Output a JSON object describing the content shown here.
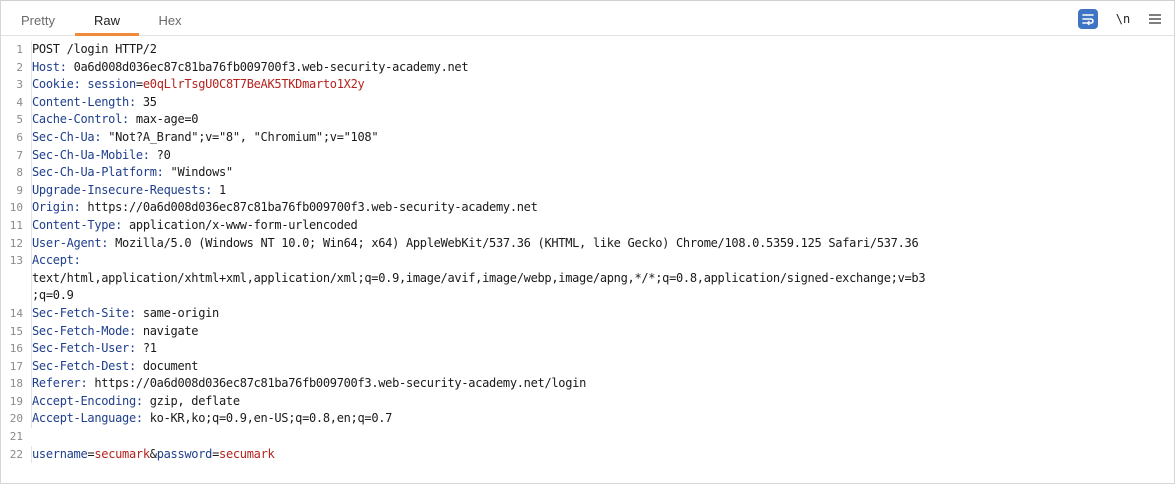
{
  "tabs": [
    {
      "label": "Pretty",
      "active": false
    },
    {
      "label": "Raw",
      "active": true
    },
    {
      "label": "Hex",
      "active": false
    }
  ],
  "toolbar": {
    "wrap_icon": "word-wrap-icon",
    "newline_label": "\\n",
    "menu_icon": "hamburger-menu-icon",
    "accent_color": "#3f74c4",
    "active_tab_color": "#f28a3b"
  },
  "request": {
    "line1": {
      "num": "1",
      "text": "POST /login HTTP/2"
    },
    "line2": {
      "num": "2",
      "name": "Host",
      "value": " 0a6d008d036ec87c81ba76fb009700f3.web-security-academy.net"
    },
    "line3": {
      "num": "3",
      "name": "Cookie",
      "cookie_name": "session",
      "cookie_value": "e0qLlrTsgU0C8T7BeAK5TKDmarto1X2y"
    },
    "line4": {
      "num": "4",
      "name": "Content-Length",
      "value": " 35"
    },
    "line5": {
      "num": "5",
      "name": "Cache-Control",
      "value": " max-age=0"
    },
    "line6": {
      "num": "6",
      "name": "Sec-Ch-Ua",
      "value": " \"Not?A_Brand\";v=\"8\", \"Chromium\";v=\"108\""
    },
    "line7": {
      "num": "7",
      "name": "Sec-Ch-Ua-Mobile",
      "value": " ?0"
    },
    "line8": {
      "num": "8",
      "name": "Sec-Ch-Ua-Platform",
      "value": " \"Windows\""
    },
    "line9": {
      "num": "9",
      "name": "Upgrade-Insecure-Requests",
      "value": " 1"
    },
    "line10": {
      "num": "10",
      "name": "Origin",
      "value": " https://0a6d008d036ec87c81ba76fb009700f3.web-security-academy.net"
    },
    "line11": {
      "num": "11",
      "name": "Content-Type",
      "value": " application/x-www-form-urlencoded"
    },
    "line12": {
      "num": "12",
      "name": "User-Agent",
      "value": " Mozilla/5.0 (Windows NT 10.0; Win64; x64) AppleWebKit/537.36 (KHTML, like Gecko) Chrome/108.0.5359.125 Safari/537.36"
    },
    "line13": {
      "num": "13",
      "name": "Accept",
      "value_a": "text/html,application/xhtml+xml,application/xml;q=0.9,image/avif,image/webp,image/apng,*/*;q=0.8,application/signed-exchange;v=b3",
      "value_b": ";q=0.9"
    },
    "line14": {
      "num": "14",
      "name": "Sec-Fetch-Site",
      "value": " same-origin"
    },
    "line15": {
      "num": "15",
      "name": "Sec-Fetch-Mode",
      "value": " navigate"
    },
    "line16": {
      "num": "16",
      "name": "Sec-Fetch-User",
      "value": " ?1"
    },
    "line17": {
      "num": "17",
      "name": "Sec-Fetch-Dest",
      "value": " document"
    },
    "line18": {
      "num": "18",
      "name": "Referer",
      "value": " https://0a6d008d036ec87c81ba76fb009700f3.web-security-academy.net/login"
    },
    "line19": {
      "num": "19",
      "name": "Accept-Encoding",
      "value": " gzip, deflate"
    },
    "line20": {
      "num": "20",
      "name": "Accept-Language",
      "value": " ko-KR,ko;q=0.9,en-US;q=0.8,en;q=0.7"
    },
    "line21": {
      "num": "21"
    },
    "line22": {
      "num": "22",
      "p1_name": "username",
      "p1_value": "secumark",
      "p2_name": "password",
      "p2_value": "secumark"
    }
  }
}
